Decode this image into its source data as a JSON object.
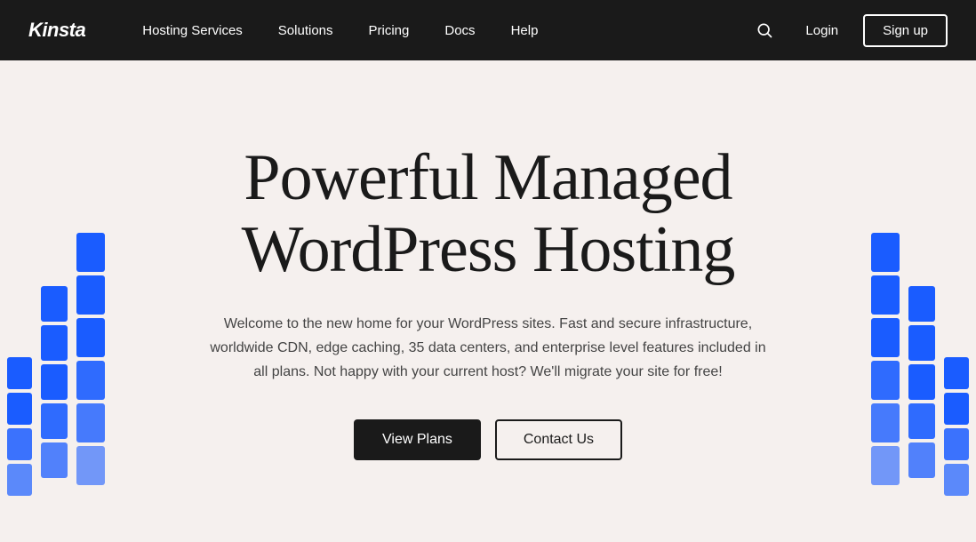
{
  "nav": {
    "logo": "Kinsta",
    "links": [
      {
        "label": "Hosting Services",
        "id": "hosting-services"
      },
      {
        "label": "Solutions",
        "id": "solutions"
      },
      {
        "label": "Pricing",
        "id": "pricing"
      },
      {
        "label": "Docs",
        "id": "docs"
      },
      {
        "label": "Help",
        "id": "help"
      }
    ],
    "login_label": "Login",
    "signup_label": "Sign up"
  },
  "hero": {
    "title_line1": "Powerful Managed",
    "title_line2": "WordPress Hosting",
    "subtitle": "Welcome to the new home for your WordPress sites. Fast and secure infrastructure, worldwide CDN, edge caching, 35 data centers, and enterprise level features included in all plans. Not happy with your current host? We'll migrate your site for free!",
    "cta_primary": "View Plans",
    "cta_secondary": "Contact Us"
  }
}
